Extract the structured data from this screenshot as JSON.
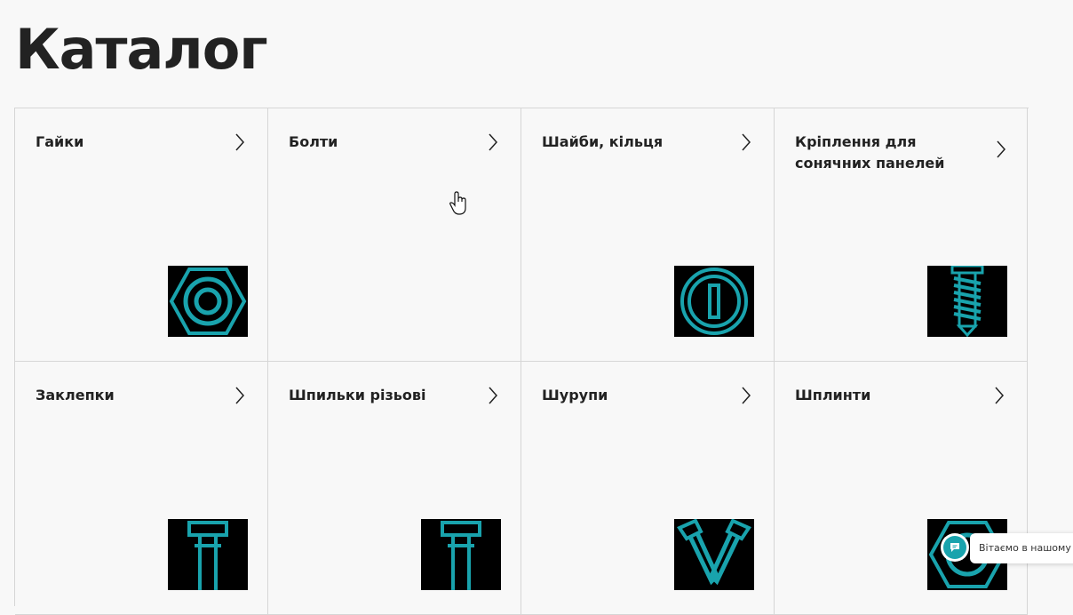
{
  "page": {
    "title": "Каталог"
  },
  "catalog": {
    "items": [
      {
        "label": "Гайки",
        "icon": "hex-nut-icon"
      },
      {
        "label": "Болти",
        "icon": ""
      },
      {
        "label": "Шайби, кільця",
        "icon": "washer-icon"
      },
      {
        "label": "Кріплення для сонячних панелей",
        "icon": "solar-mount-screw-icon"
      },
      {
        "label": "Заклепки",
        "icon": "rivet-icon"
      },
      {
        "label": "Шпильки різьові",
        "icon": "threaded-stud-icon"
      },
      {
        "label": "Шурупи",
        "icon": "wood-screws-icon"
      },
      {
        "label": "Шплинти",
        "icon": "cotter-pin-icon"
      }
    ]
  },
  "chat": {
    "message": "Вітаємо в нашому ма"
  },
  "colors": {
    "accent": "#19a3ad",
    "thumb_bg": "#000000",
    "border": "#d6d6d6"
  }
}
